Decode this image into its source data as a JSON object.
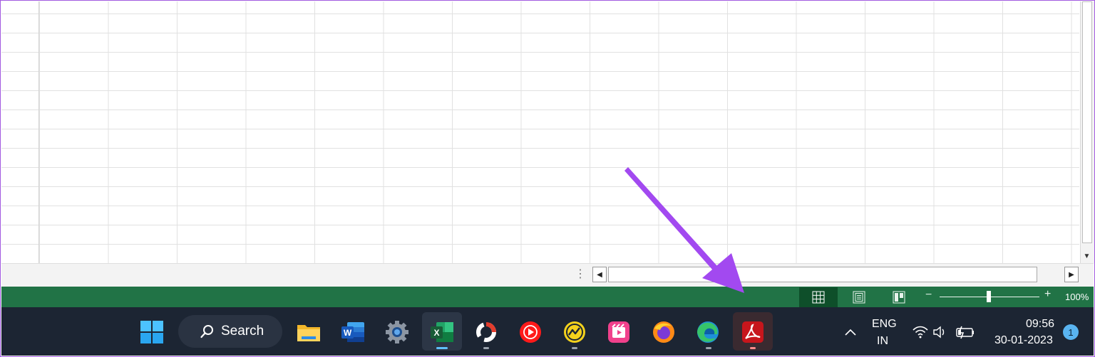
{
  "search": {
    "label": "Search"
  },
  "tray": {
    "language_line1": "ENG",
    "language_line2": "IN",
    "time": "09:56",
    "date": "30-01-2023",
    "notification_count": "1"
  },
  "statusbar": {
    "zoom_value": "100%"
  },
  "colors": {
    "excel_green": "#217346",
    "taskbar_bg": "#1c2533",
    "annotation_arrow": "#a249f0"
  },
  "taskbar": {
    "icons": [
      "windows-start-icon",
      "search-icon",
      "file-explorer-icon",
      "word-icon",
      "settings-icon",
      "excel-icon",
      "app-ring-icon",
      "youtube-music-icon",
      "chart-app-icon",
      "video-editor-icon",
      "firefox-icon",
      "edge-icon",
      "acrobat-icon"
    ]
  }
}
